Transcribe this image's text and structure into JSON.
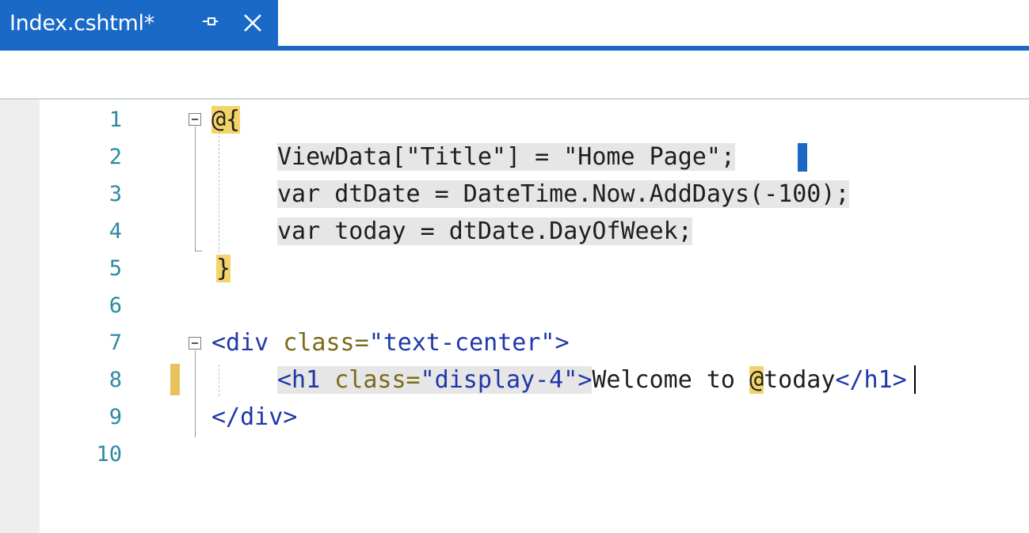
{
  "tab": {
    "title": "Index.cshtml*",
    "pin_icon": "pin-icon",
    "close_icon": "close-icon"
  },
  "editor": {
    "line_numbers": [
      "1",
      "2",
      "3",
      "4",
      "5",
      "6",
      "7",
      "8",
      "9",
      "10"
    ],
    "lines": {
      "l1": {
        "razor": "@{"
      },
      "l2": {
        "text": "ViewData[\"Title\"] = \"Home Page\";"
      },
      "l3": {
        "text": "var dtDate = DateTime.Now.AddDays(-100);"
      },
      "l4": {
        "text": "var today = dtDate.DayOfWeek;"
      },
      "l5": {
        "razor": "}"
      },
      "l7": {
        "open": "<div ",
        "attr": "class=",
        "value": "\"text-center\"",
        "close": ">"
      },
      "l8": {
        "open": "<h1 ",
        "attr": "class=",
        "value": "\"display-4\"",
        "close": ">",
        "text": "Welcome to ",
        "razor_at": "@",
        "razor_var": "today",
        "end": "</h1>"
      },
      "l9": {
        "end": "</div>"
      }
    }
  },
  "colors": {
    "accent": "#1a69c7",
    "razor_highlight": "#f4d46a",
    "line_number": "#2b8aa3"
  }
}
